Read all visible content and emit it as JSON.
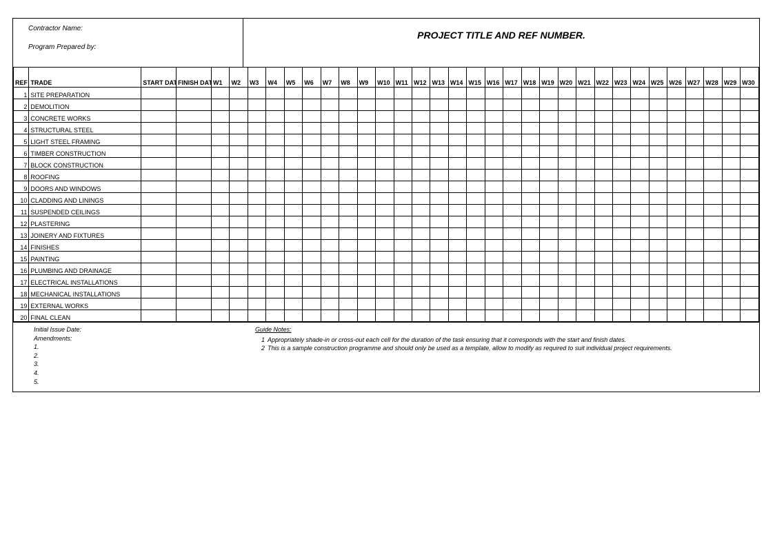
{
  "header": {
    "contractor_label": "Contractor Name:",
    "prepared_label": "Program Prepared by:",
    "title": "PROJECT TITLE AND REF NUMBER."
  },
  "columns": {
    "ref": "REF",
    "trade": "TRADE",
    "start_date": "START DATE",
    "finish_date": "FINISH DATE"
  },
  "weeks": [
    "W1",
    "W2",
    "W3",
    "W4",
    "W5",
    "W6",
    "W7",
    "W8",
    "W9",
    "W10",
    "W11",
    "W12",
    "W13",
    "W14",
    "W15",
    "W16",
    "W17",
    "W18",
    "W19",
    "W20",
    "W21",
    "W22",
    "W23",
    "W24",
    "W25",
    "W26",
    "W27",
    "W28",
    "W29",
    "W30"
  ],
  "rows": [
    {
      "ref": "1",
      "trade": "SITE PREPARATION"
    },
    {
      "ref": "2",
      "trade": "DEMOLITION"
    },
    {
      "ref": "3",
      "trade": "CONCRETE WORKS"
    },
    {
      "ref": "4",
      "trade": "STRUCTURAL STEEL"
    },
    {
      "ref": "5",
      "trade": "LIGHT STEEL FRAMING"
    },
    {
      "ref": "6",
      "trade": "TIMBER CONSTRUCTION"
    },
    {
      "ref": "7",
      "trade": "BLOCK CONSTRUCTION"
    },
    {
      "ref": "8",
      "trade": "ROOFING"
    },
    {
      "ref": "9",
      "trade": "DOORS AND WINDOWS"
    },
    {
      "ref": "10",
      "trade": "CLADDING AND LININGS"
    },
    {
      "ref": "11",
      "trade": "SUSPENDED CEILINGS"
    },
    {
      "ref": "12",
      "trade": "PLASTERING"
    },
    {
      "ref": "13",
      "trade": "JOINERY AND FIXTURES"
    },
    {
      "ref": "14",
      "trade": "FINISHES"
    },
    {
      "ref": "15",
      "trade": "PAINTING"
    },
    {
      "ref": "16",
      "trade": "PLUMBING AND DRAINAGE"
    },
    {
      "ref": "17",
      "trade": "ELECTRICAL INSTALLATIONS"
    },
    {
      "ref": "18",
      "trade": "MECHANICAL INSTALLATIONS"
    },
    {
      "ref": "19",
      "trade": "EXTERNAL WORKS"
    },
    {
      "ref": "20",
      "trade": "FINAL CLEAN"
    }
  ],
  "footer": {
    "issue_date_label": "Initial Issue Date:",
    "amendments_label": "Amendments:",
    "amendments": [
      "1.",
      "2.",
      "3.",
      "4.",
      "5."
    ],
    "guide_title": "Guide Notes:",
    "guide_notes": [
      {
        "num": "1",
        "text": "Appropriately shade-in or cross-out each cell for the duration of the task ensuring that it corresponds with the start and finish dates."
      },
      {
        "num": "2",
        "text": "This is a sample construction programme and should only be used as a template, allow to modify as required to suit individual project requirements."
      }
    ]
  }
}
